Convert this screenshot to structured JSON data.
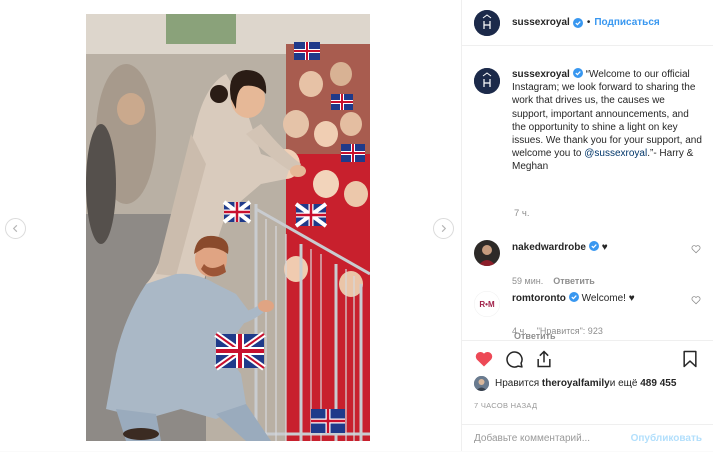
{
  "post": {
    "author": "sussexroyal",
    "follow_label": "Подписаться",
    "separator": "•",
    "caption_prefix": "“Welcome to our official Instagram; we look forward to sharing the work that drives us, the causes we support, important announcements, and the opportunity to shine a light on key issues. We thank you for your support, and welcome you to ",
    "caption_mention": "@sussexroyal",
    "caption_suffix": ".”- Harry & Meghan",
    "time": "7 ч."
  },
  "comments": [
    {
      "user": "nakedwardrobe",
      "text": "♥",
      "time": "59 мин.",
      "reply": "Ответить"
    },
    {
      "user": "romtoronto",
      "text": "Welcome! ♥",
      "time": "4 ч.",
      "likes": "\"Нравится\": 923",
      "reply": "Ответить",
      "avatar_text": "R•M"
    }
  ],
  "likes": {
    "prefix": "Нравится ",
    "user": "theroyalfamily",
    "suffix": " и ещё ",
    "count": "489 455"
  },
  "posted_ago": "7 ЧАСОВ НАЗАД",
  "comment_box": {
    "placeholder": "Добавьте комментарий...",
    "publish": "Опубликовать"
  },
  "icons": {
    "like": "heart-icon",
    "comment": "comment-icon",
    "share": "share-icon",
    "save": "bookmark-icon"
  },
  "colors": {
    "link_blue": "#3897f0",
    "liked_red": "#ed4956",
    "mention": "#003569",
    "muted": "#8e8e8e"
  }
}
